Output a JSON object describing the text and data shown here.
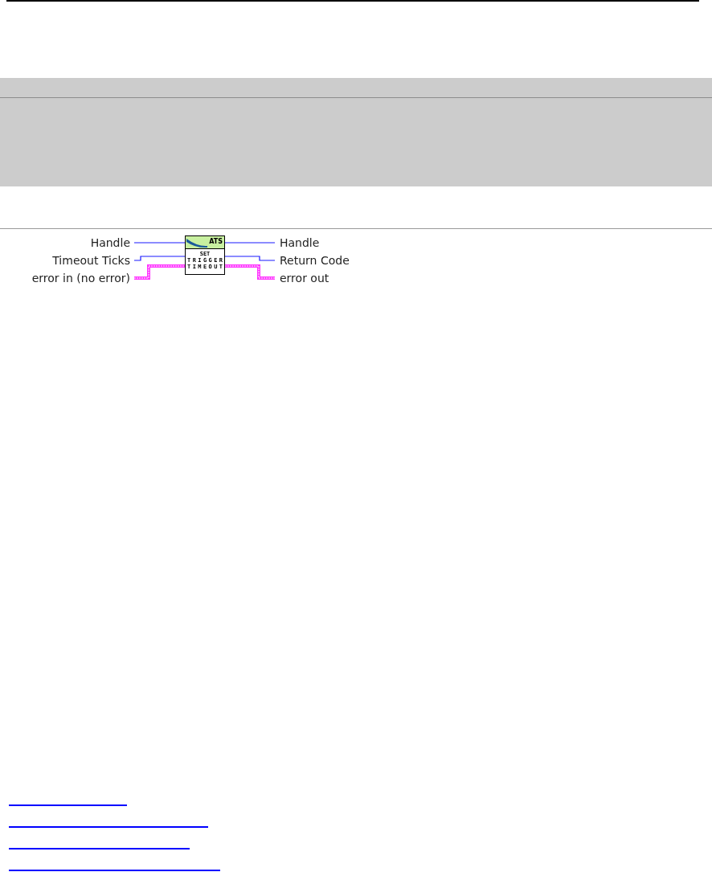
{
  "diagram": {
    "node": {
      "banner": "ATS",
      "lines": [
        "SET",
        "TRIGGER",
        "TIMEOUT"
      ]
    },
    "inputs": [
      {
        "label": "Handle",
        "kind": "numeric"
      },
      {
        "label": "Timeout Ticks",
        "kind": "numeric"
      },
      {
        "label": "error in (no error)",
        "kind": "error"
      }
    ],
    "outputs": [
      {
        "label": "Handle",
        "kind": "numeric"
      },
      {
        "label": "Return Code",
        "kind": "numeric"
      },
      {
        "label": "error out",
        "kind": "error"
      }
    ]
  },
  "links": [
    {
      "kind": "empty"
    },
    {
      "kind": "empty"
    },
    {
      "kind": "empty"
    },
    {
      "kind": "empty"
    }
  ]
}
